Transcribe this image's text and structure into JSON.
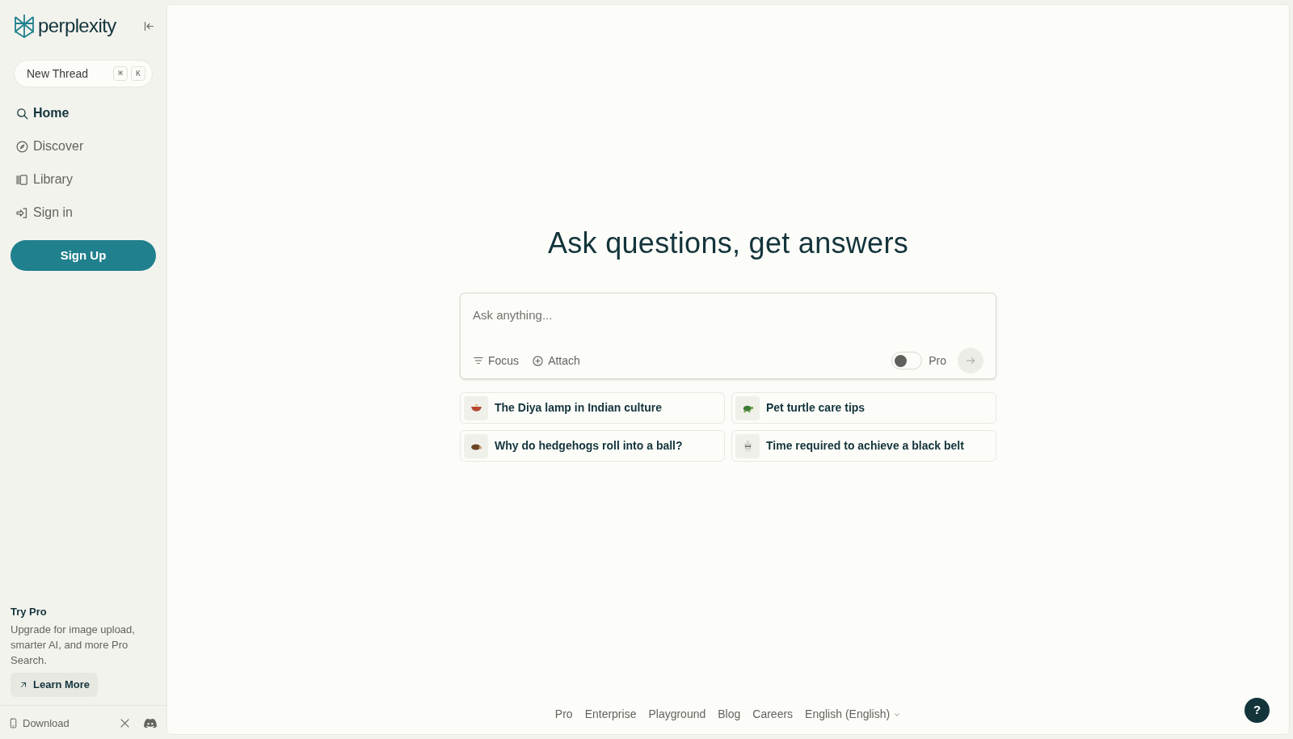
{
  "sidebar": {
    "logo": "perplexity",
    "new_thread": {
      "label": "New Thread",
      "keys": [
        "⌘",
        "K"
      ]
    },
    "items": [
      {
        "kind": "search",
        "label": "Home",
        "selected": true
      },
      {
        "kind": "compass",
        "label": "Discover",
        "selected": false
      },
      {
        "kind": "library",
        "label": "Library",
        "selected": false
      },
      {
        "kind": "signin",
        "label": "Sign in",
        "selected": false
      }
    ],
    "sign_up": "Sign Up",
    "promo": {
      "title": "Try Pro",
      "text": "Upgrade for image upload, smarter AI, and more Pro Search.",
      "button": "Learn More"
    },
    "footer": {
      "download": "Download"
    }
  },
  "main": {
    "heading": "Ask questions, get answers",
    "search": {
      "placeholder": "Ask anything...",
      "focus": "Focus",
      "attach": "Attach",
      "pro_toggle": {
        "label": "Pro",
        "on": false
      }
    },
    "suggestions": [
      {
        "text": "The Diya lamp in Indian culture"
      },
      {
        "text": "Pet turtle care tips"
      },
      {
        "text": "Why do hedgehogs roll into a ball?"
      },
      {
        "text": "Time required to achieve a black belt"
      }
    ],
    "footer_links": [
      "Pro",
      "Enterprise",
      "Playground",
      "Blog",
      "Careers"
    ],
    "language": "English (English)",
    "help": "?"
  }
}
